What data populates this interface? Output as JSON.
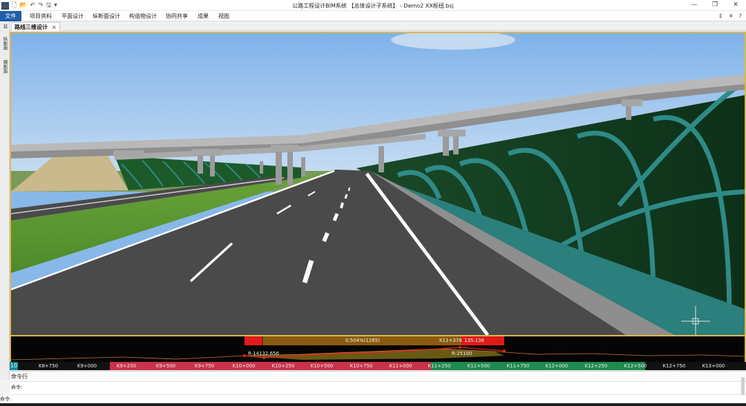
{
  "window": {
    "title": "公路工程设计BIM系统 【总体设计子系统】 - Demo2 XX枢纽.bsj",
    "logo_glyph": "▣",
    "quick_access": [
      "🗋",
      "📂",
      "↶",
      "↷",
      "🖫",
      "▾"
    ],
    "controls": [
      "—",
      "❐",
      "✕"
    ]
  },
  "menu": {
    "items": [
      "文件",
      "项目资料",
      "平面设计",
      "纵断面设计",
      "构造物设计",
      "协同共享",
      "成果",
      "视图"
    ],
    "right_icons": [
      "⇕",
      "⚘",
      "?"
    ]
  },
  "left_panel": {
    "tabs": [
      "目",
      "纵断面",
      "横断面"
    ]
  },
  "document": {
    "active_tab": "路线三维设计",
    "close_glyph": "×"
  },
  "profile": {
    "grade_label": "0.504%(1265)",
    "station_label": "K11+378",
    "station_value": "135.136",
    "curve_left_label": "R-14132.656",
    "curve_right_label": "R-25100"
  },
  "ruler": {
    "zoom_level": "10",
    "ticks": [
      "K8+750",
      "K9+000",
      "K9+250",
      "K9+500",
      "K9+750",
      "K10+000",
      "K10+250",
      "K10+500",
      "K10+750",
      "K11+000",
      "K11+250",
      "K11+500",
      "K11+750",
      "K12+000",
      "K12+250",
      "K12+500",
      "K12+750",
      "K13+000"
    ]
  },
  "command": {
    "title": "命令行",
    "history_line": "命令:",
    "prompt": "命令:",
    "input_value": "",
    "input_placeholder": ""
  },
  "colors": {
    "accent": "#1f5ea8",
    "viewport_border": "#e0b84a",
    "ruler_red": "#c8334a",
    "ruler_green": "#1e8a4e",
    "ruler_zoom": "#0a8a99"
  }
}
